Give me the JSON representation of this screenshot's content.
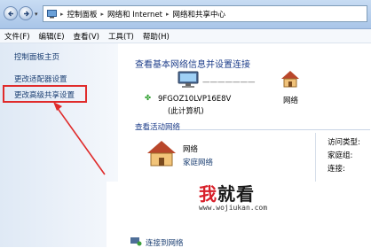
{
  "breadcrumb": [
    "控制面板",
    "网络和 Internet",
    "网络和共享中心"
  ],
  "menu": [
    "文件(F)",
    "编辑(E)",
    "查看(V)",
    "工具(T)",
    "帮助(H)"
  ],
  "sidebar": {
    "items": [
      "控制面板主页",
      "更改适配器设置",
      "更改高级共享设置"
    ],
    "highlighted_index": 2
  },
  "main": {
    "title": "查看基本网络信息并设置连接",
    "computer_name": "9FGOZ10LVP16E8V",
    "computer_sub": "(此计算机)",
    "network_label": "网络",
    "active_title": "查看活动网络",
    "active_network_name": "网络",
    "active_network_type": "家庭网络",
    "details_labels": [
      "访问类型:",
      "家庭组:",
      "连接:"
    ],
    "bottom_link": "连接到网络"
  },
  "watermark": {
    "logo_red": "我",
    "logo_rest": "就看",
    "url": "www.wojiukan.com"
  },
  "colors": {
    "link": "#1a3e72",
    "heading": "#1e3e8a",
    "highlight": "#e02b2b"
  }
}
